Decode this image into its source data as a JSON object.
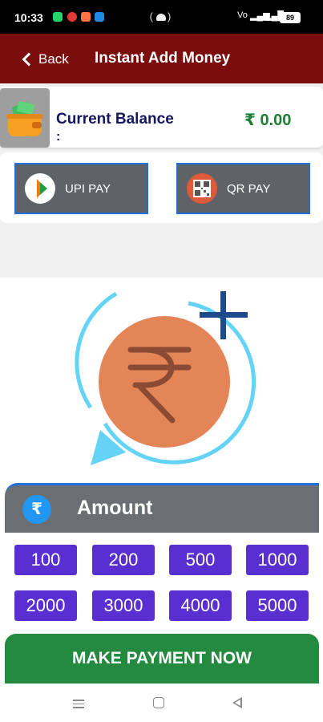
{
  "status_bar": {
    "time": "10:33",
    "signal_text": "Vo LTE",
    "battery": "89"
  },
  "header": {
    "back_label": "Back",
    "title": "Instant Add Money",
    "background_color": "#7b0d0d"
  },
  "balance": {
    "label": "Current Balance",
    "colon": ":",
    "value": "₹ 0.00",
    "value_color": "#1e7e34"
  },
  "payment_methods": [
    {
      "label": "UPI PAY",
      "icon": "upi-logo-icon"
    },
    {
      "label": "QR PAY",
      "icon": "qr-code-icon"
    }
  ],
  "amount_section": {
    "title": "Amount",
    "icon_symbol": "₹",
    "options": [
      "100",
      "200",
      "500",
      "1000",
      "2000",
      "3000",
      "4000",
      "5000"
    ],
    "chip_color": "#5a2fd1"
  },
  "cta": {
    "label": "MAKE PAYMENT NOW",
    "color": "#238a3f"
  }
}
